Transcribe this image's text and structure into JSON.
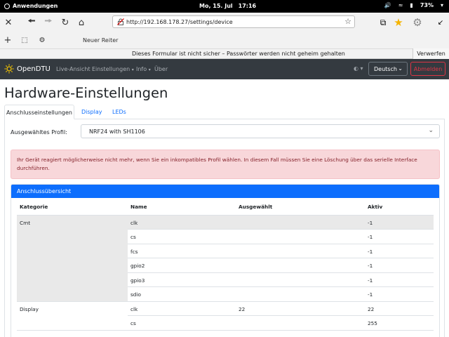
{
  "system_bar": {
    "activities": "Anwendungen",
    "date": "Mo, 15. Jul",
    "time": "17:16",
    "battery": "73%"
  },
  "browser": {
    "url": "http://192.168.178.27/settings/device",
    "new_tab_label": "Neuer Reiter",
    "security_warning": "Dieses Formular ist nicht sicher – Passwörter werden nicht geheim gehalten",
    "dismiss_label": "Verwerfen"
  },
  "navbar": {
    "brand": "OpenDTU",
    "links": [
      "Live-Ansicht",
      "Einstellungen",
      "Info",
      "Über"
    ],
    "language": "Deutsch",
    "logout": "Abmelden"
  },
  "page": {
    "title": "Hardware-Einstellungen",
    "tabs": [
      "Anschlusseinstellungen",
      "Display",
      "LEDs"
    ],
    "active_tab": "Anschlusseinstellungen",
    "profile_label": "Ausgewähltes Profil:",
    "profile_value": "NRF24 with SH1106",
    "alert": "Ihr Gerät reagiert möglicherweise nicht mehr, wenn Sie ein inkompatibles Profil wählen. In diesem Fall müssen Sie eine Löschung über das serielle Interface durchführen.",
    "panel_title": "Anschlussübersicht"
  },
  "table": {
    "headers": [
      "Kategorie",
      "Name",
      "Ausgewählt",
      "Aktiv"
    ],
    "rows": [
      {
        "category": "Cmt",
        "name": "clk",
        "selected": "",
        "active": "-1"
      },
      {
        "category": "",
        "name": "cs",
        "selected": "",
        "active": "-1"
      },
      {
        "category": "",
        "name": "fcs",
        "selected": "",
        "active": "-1"
      },
      {
        "category": "",
        "name": "gpio2",
        "selected": "",
        "active": "-1"
      },
      {
        "category": "",
        "name": "gpio3",
        "selected": "",
        "active": "-1"
      },
      {
        "category": "",
        "name": "sdio",
        "selected": "",
        "active": "-1"
      },
      {
        "category": "Display",
        "name": "clk",
        "selected": "22",
        "active": "22"
      },
      {
        "category": "",
        "name": "cs",
        "selected": "",
        "active": "255"
      }
    ]
  },
  "colors": {
    "navbar_bg": "#343a40",
    "primary": "#0d6efd",
    "danger": "#dc3545",
    "alert_bg": "#f8d7da"
  }
}
